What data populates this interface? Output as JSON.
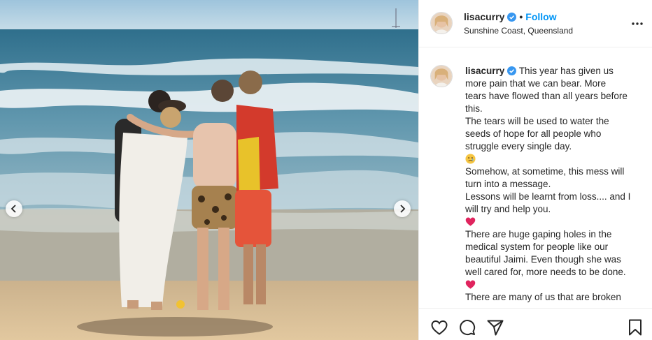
{
  "post": {
    "username": "lisacurry",
    "follow_label": "Follow",
    "separator": "•",
    "location": "Sunshine Coast, Queensland"
  },
  "caption": {
    "username": "lisacurry",
    "lines": [
      "This year has given us",
      "more pain that we can bear. More",
      "tears have flowed than all years before",
      "this.",
      "The tears will be used to water the",
      "seeds of hope for all people who",
      "struggle every single day.",
      "Somehow, at sometime, this mess will",
      "turn into a message.",
      "Lessons will be learnt from loss.... and I",
      "will try and help you.",
      "There are huge gaping holes in the",
      "medical system for people like our",
      "beautiful Jaimi. Even though she was",
      "well cared for, more needs to be done.",
      "There are many of us that are broken"
    ],
    "emojis": [
      "sad-face",
      "red-heart",
      "red-heart"
    ]
  },
  "icons": {
    "verified": "verified-badge-icon",
    "more": "more-options-icon",
    "prev": "chevron-left-icon",
    "next": "chevron-right-icon",
    "like": "heart-icon",
    "comment": "comment-icon",
    "share": "paper-plane-icon",
    "save": "bookmark-icon"
  },
  "colors": {
    "accent": "#0095f6",
    "text": "#262626",
    "heart": "#e0245e"
  }
}
